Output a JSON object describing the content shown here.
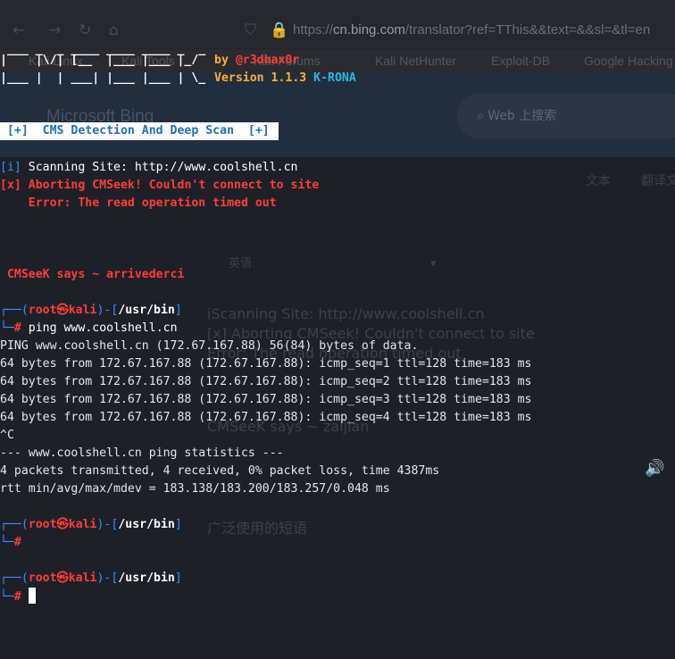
{
  "browser": {
    "url_domain": "cn.bing.com",
    "url_rest": "/translator?ref=TThis&&text=&&sl=&tl=en",
    "bookmarks": [
      "Kali Linux",
      "Kali Tools",
      "Kali Forums",
      "Kali NetHunter",
      "Exploit-DB",
      "Google Hacking"
    ],
    "logo": "Microsoft Bing",
    "search_placeholder": "Web 上搜索",
    "tab_text": "文本",
    "tab_doc": "翻译文",
    "lang_select": "英语",
    "ghost_lines": [
      "iScanning Site: http://www.coolshell.cn",
      "[x] Aborting CMSeek! Couldn't connect to site",
      "Error: The read operation timed out",
      "CMSeeK says ~ zaijian"
    ],
    "ghost_phrase": "广泛使用的短语"
  },
  "terminal": {
    "ascii_art": [
      " ___ _  _ ____ ____ ____ _  _",
      "|    |\\/| [__  |___ |___ |_/ ",
      "|___ |  | ___| |___ |___ | \\_"
    ],
    "by_label": "by",
    "author": "@r3dhax0r",
    "version": "Version 1.1.3",
    "edition": "K-RONA",
    "banner": " [+]  CMS Detection And Deep Scan  [+]",
    "scan_tag": "[i]",
    "scan_text": " Scanning Site: http://www.coolshell.cn",
    "abort_tag": "[x]",
    "abort_text": " Aborting CMSeek! Couldn't connect to site",
    "error_text": "    Error: The read operation timed out",
    "says": " CMSeeK says ~ arrivederci",
    "prompt_user": "root",
    "prompt_at": "㉿",
    "prompt_host": "kali",
    "prompt_path": "/usr/bin",
    "command": "ping www.coolshell.cn",
    "ping_output": [
      "PING www.coolshell.cn (172.67.167.88) 56(84) bytes of data.",
      "64 bytes from 172.67.167.88 (172.67.167.88): icmp_seq=1 ttl=128 time=183 ms",
      "64 bytes from 172.67.167.88 (172.67.167.88): icmp_seq=2 ttl=128 time=183 ms",
      "64 bytes from 172.67.167.88 (172.67.167.88): icmp_seq=3 ttl=128 time=183 ms",
      "64 bytes from 172.67.167.88 (172.67.167.88): icmp_seq=4 ttl=128 time=183 ms",
      "^C",
      "--- www.coolshell.cn ping statistics ---",
      "4 packets transmitted, 4 received, 0% packet loss, time 4387ms",
      "rtt min/avg/max/mdev = 183.138/183.200/183.257/0.048 ms"
    ]
  },
  "colors": {
    "background": "#1e2028",
    "prompt_frame": "#3f8cff",
    "prompt_user": "#ff3c3c",
    "error": "#ff3c3c",
    "accent_orange": "#ffa033"
  }
}
